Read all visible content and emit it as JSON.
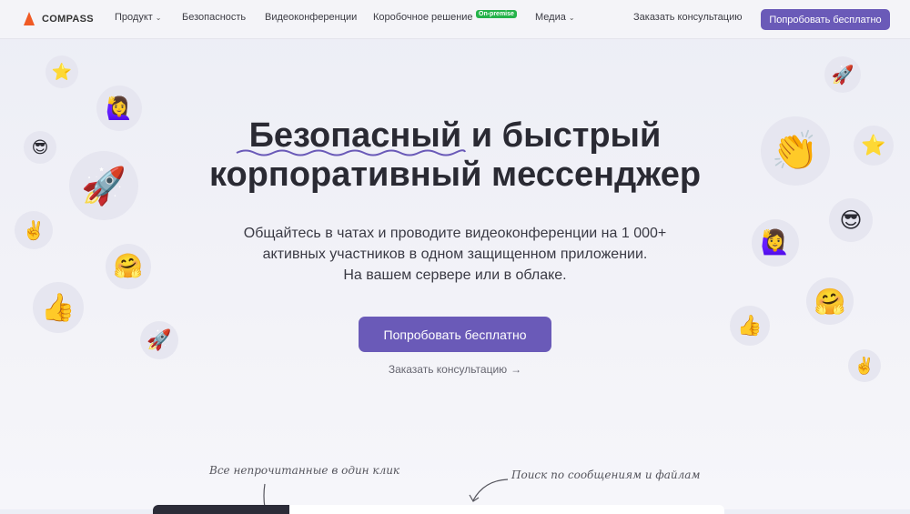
{
  "nav": {
    "logo_text": "COMPASS",
    "items": [
      {
        "label": "Продукт"
      },
      {
        "label": "Безопасность"
      },
      {
        "label": "Видеоконференции"
      },
      {
        "label": "Коробочное решение"
      },
      {
        "label": "Медиа"
      }
    ],
    "badge": "On-premise",
    "consult": "Заказать консультацию",
    "try": "Попробовать бесплатно"
  },
  "hero": {
    "title_line1": "Безопасный и быстрый",
    "title_line2": "корпоративный мессенджер",
    "subtitle_line1": "Общайтесь в чатах и проводите видеоконференции на 1 000+",
    "subtitle_line2": "активных участников в одном защищенном приложении.",
    "subtitle_line3": "На вашем сервере или в облаке.",
    "cta": "Попробовать бесплатно",
    "consult": "Заказать консультацию"
  },
  "notes": {
    "unread": "Все непрочитанные в один клик",
    "search": "Поиск по сообщениям и файлам"
  },
  "emojis": {
    "star": "⭐",
    "woman_raising_hand": "🙋‍♀️",
    "sunglasses": "😎",
    "rocket": "🚀",
    "victory": "✌️",
    "hugging": "🤗",
    "thumbs_up": "👍",
    "clapping": "👏"
  },
  "colors": {
    "accent": "#6a5ab8",
    "logo": "#f05a24",
    "badge": "#25b34a"
  }
}
